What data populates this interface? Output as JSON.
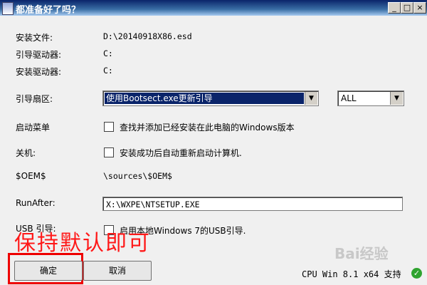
{
  "window": {
    "title": "都准备好了吗？",
    "minimize": "_",
    "maximize": "□",
    "close": "×"
  },
  "fields": {
    "install_file": {
      "label": "安装文件:",
      "value": "D:\\20140918X86.esd"
    },
    "boot_drive": {
      "label": "引导驱动器:",
      "value": "C:"
    },
    "install_drive": {
      "label": "安装驱动器:",
      "value": "C:"
    }
  },
  "boot_sector": {
    "label": "引导扇区:",
    "selected": "使用Bootsect.exe更新引导",
    "mode_selected": "ALL"
  },
  "boot_menu": {
    "label": "启动菜单",
    "checkbox_label": "查找并添加已经安装在此电脑的Windows版本",
    "checked": false
  },
  "shutdown": {
    "label": "关机:",
    "checkbox_label": "安装成功后自动重新启动计算机.",
    "checked": false
  },
  "oem": {
    "label": "$OEM$",
    "value": "\\sources\\$OEM$"
  },
  "runafter": {
    "label": "RunAfter:",
    "value": "X:\\WXPE\\NTSETUP.EXE"
  },
  "usb_boot": {
    "label": "USB 引导:",
    "checkbox_label": "启用本地Windows 7的USB引导.",
    "checked": false
  },
  "annotation": "保持默认即可",
  "buttons": {
    "ok": "确定",
    "cancel": "取消"
  },
  "status": {
    "text": "CPU Win 8.1 x64 支持",
    "icon": "check-icon"
  },
  "watermark": "Bai经验",
  "colors": {
    "annotation": "#ff1818",
    "title_bar": "#0a246a",
    "status_ok": "#2fa32f"
  }
}
